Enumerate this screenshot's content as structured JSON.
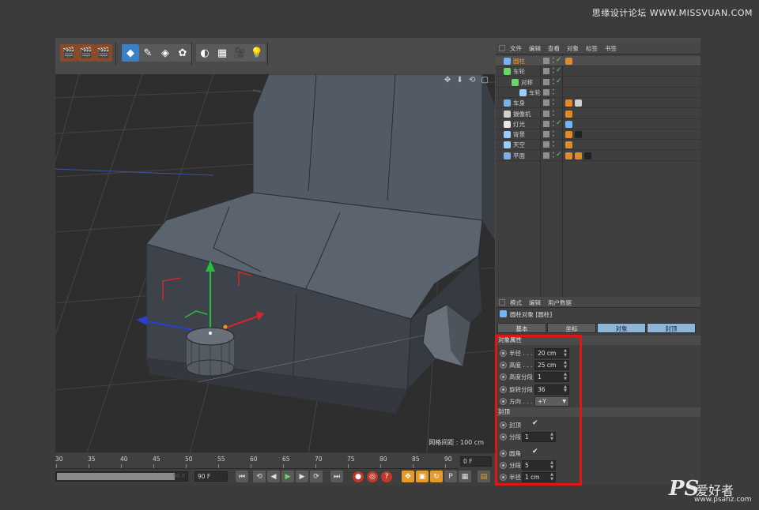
{
  "watermark_top": "思缘设计论坛 WWW.MISSVUAN.COM",
  "toolbar": {
    "buttons": [
      {
        "name": "render-view-icon",
        "glyph": "🎬"
      },
      {
        "name": "render-picture-viewer-icon",
        "glyph": "🎬"
      },
      {
        "name": "edit-render-settings-icon",
        "glyph": "🎬"
      },
      {
        "name": "cube-icon",
        "glyph": "◆"
      },
      {
        "name": "spline-pen-icon",
        "glyph": "✎"
      },
      {
        "name": "nurbs-icon",
        "glyph": "◈"
      },
      {
        "name": "array-icon",
        "glyph": "✿"
      },
      {
        "name": "deformer-icon",
        "glyph": "◐"
      },
      {
        "name": "floor-icon",
        "glyph": "▦"
      },
      {
        "name": "camera-icon",
        "glyph": "🎥"
      },
      {
        "name": "light-icon",
        "glyph": "💡"
      }
    ]
  },
  "viewport": {
    "controls": "✥ ⬇ ⟲ ▢",
    "grid_label": "网格间距 : 100 cm"
  },
  "timeline": {
    "ticks": [
      "30",
      "35",
      "40",
      "45",
      "50",
      "55",
      "60",
      "65",
      "70",
      "75",
      "80",
      "85",
      "90"
    ],
    "current_frame": "0 F",
    "range_end_label": "90 F",
    "end_frame": "90 F",
    "range_fill_fraction": 0.9
  },
  "object_manager": {
    "menu": [
      "文件",
      "编辑",
      "查看",
      "对象",
      "标签",
      "书签"
    ],
    "rows": [
      {
        "name": "圆柱",
        "indent": 0,
        "selected": true,
        "icon_color": "#6fb5ff",
        "visible": true,
        "tags": [
          "#e08a2b"
        ]
      },
      {
        "name": "车轮",
        "indent": 0,
        "selected": false,
        "icon_color": "#6fd36b",
        "visible": true,
        "tags": []
      },
      {
        "name": "对称",
        "indent": 1,
        "selected": false,
        "icon_color": "#6fd36b",
        "visible": true,
        "tags": []
      },
      {
        "name": "车轮",
        "indent": 2,
        "selected": false,
        "icon_color": "#9ecbff",
        "visible": false,
        "tags": []
      },
      {
        "name": "车身",
        "indent": 0,
        "selected": false,
        "icon_color": "#7ab0e8",
        "visible": false,
        "tags": [
          "#e08a2b",
          "#d0d0d0"
        ]
      },
      {
        "name": "摄像机",
        "indent": 0,
        "selected": false,
        "icon_color": "#cfcfcf",
        "visible": false,
        "tags": [
          "#e08a2b"
        ]
      },
      {
        "name": "灯光",
        "indent": 0,
        "selected": false,
        "icon_color": "#e8e8e8",
        "visible": true,
        "tags": [
          "#6fb5ff"
        ]
      },
      {
        "name": "背景",
        "indent": 0,
        "selected": false,
        "icon_color": "#9ecbff",
        "visible": false,
        "tags": [
          "#e08a2b",
          "#222222"
        ]
      },
      {
        "name": "天空",
        "indent": 0,
        "selected": false,
        "icon_color": "#9ecbff",
        "visible": false,
        "tags": [
          "#e08a2b"
        ]
      },
      {
        "name": "平面",
        "indent": 0,
        "selected": false,
        "icon_color": "#7ab0e8",
        "visible": true,
        "tags": [
          "#e08a2b",
          "#e08a2b",
          "#222222"
        ]
      }
    ]
  },
  "attribute_manager": {
    "menu": [
      "模式",
      "编辑",
      "用户数据"
    ],
    "title": "圆柱对象 [圆柱]",
    "tabs": [
      {
        "label": "基本",
        "active": false
      },
      {
        "label": "坐标",
        "active": false
      },
      {
        "label": "对象",
        "active": true
      },
      {
        "label": "封顶",
        "active": true
      }
    ],
    "object_section": "对象属性",
    "object_props": [
      {
        "label": "半径 . . . .",
        "value": "20 cm",
        "type": "number"
      },
      {
        "label": "高度 . . . .",
        "value": "25 cm",
        "type": "number"
      },
      {
        "label": "高度分段",
        "value": "1",
        "type": "number"
      },
      {
        "label": "旋转分段",
        "value": "36",
        "type": "number"
      },
      {
        "label": "方向 . . . .",
        "value": "+Y",
        "type": "dropdown"
      }
    ],
    "caps_section": "封顶",
    "caps_props": [
      {
        "label": "封顶",
        "value": "✔",
        "type": "check"
      },
      {
        "label": "分段",
        "value": "1",
        "type": "number"
      },
      {
        "label": "圆角",
        "value": "✔",
        "type": "check"
      },
      {
        "label": "分段",
        "value": "5",
        "type": "number"
      },
      {
        "label": "半径",
        "value": "1 cm",
        "type": "number"
      }
    ]
  },
  "logo": {
    "ps": "PS",
    "cn": "爱好者",
    "url": "www.psahz.com"
  }
}
